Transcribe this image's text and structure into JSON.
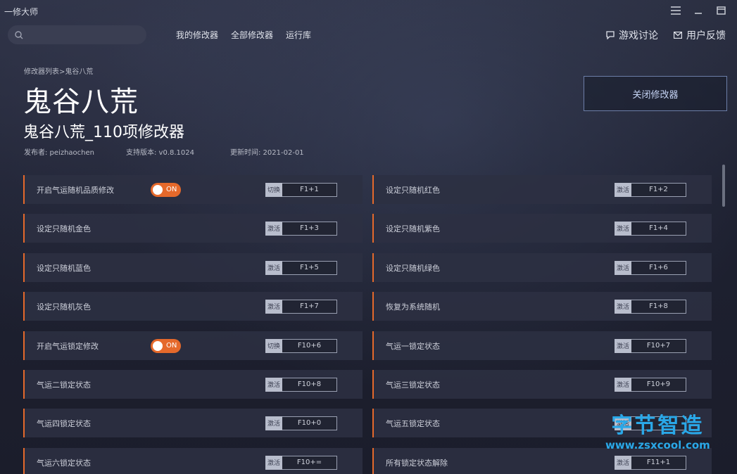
{
  "app": {
    "title": "一修大师"
  },
  "search": {
    "placeholder": ""
  },
  "nav": {
    "my_trainers": "我的修改器",
    "all_trainers": "全部修改器",
    "runtime": "运行库"
  },
  "right_nav": {
    "discussion": "游戏讨论",
    "feedback": "用户反馈"
  },
  "breadcrumb": "修改器列表>鬼谷八荒",
  "game_title": "鬼谷八荒",
  "trainer_title": "鬼谷八荒_110项修改器",
  "meta": {
    "publisher": "发布者:  peizhaochen",
    "version": "支持版本:  v0.8.1024",
    "updated": "更新时间:  2021-02-01"
  },
  "close_button": "关闭修改器",
  "cheats": [
    {
      "label": "开启气运随机品质修改",
      "toggle": "ON",
      "action": "切换",
      "key": "F1+1"
    },
    {
      "label": "设定只随机红色",
      "toggle": null,
      "action": "激活",
      "key": "F1+2"
    },
    {
      "label": "设定只随机金色",
      "toggle": null,
      "action": "激活",
      "key": "F1+3"
    },
    {
      "label": "设定只随机紫色",
      "toggle": null,
      "action": "激活",
      "key": "F1+4"
    },
    {
      "label": "设定只随机蓝色",
      "toggle": null,
      "action": "激活",
      "key": "F1+5"
    },
    {
      "label": "设定只随机绿色",
      "toggle": null,
      "action": "激活",
      "key": "F1+6"
    },
    {
      "label": "设定只随机灰色",
      "toggle": null,
      "action": "激活",
      "key": "F1+7"
    },
    {
      "label": "恢复为系统随机",
      "toggle": null,
      "action": "激活",
      "key": "F1+8"
    },
    {
      "label": "开启气运锁定修改",
      "toggle": "ON",
      "action": "切换",
      "key": "F10+6"
    },
    {
      "label": "气运一锁定状态",
      "toggle": null,
      "action": "激活",
      "key": "F10+7"
    },
    {
      "label": "气运二锁定状态",
      "toggle": null,
      "action": "激活",
      "key": "F10+8"
    },
    {
      "label": "气运三锁定状态",
      "toggle": null,
      "action": "激活",
      "key": "F10+9"
    },
    {
      "label": "气运四锁定状态",
      "toggle": null,
      "action": "激活",
      "key": "F10+0"
    },
    {
      "label": "气运五锁定状态",
      "toggle": null,
      "action": "激活",
      "key": ""
    },
    {
      "label": "气运六锁定状态",
      "toggle": null,
      "action": "激活",
      "key": "F10+="
    },
    {
      "label": "所有锁定状态解除",
      "toggle": null,
      "action": "激活",
      "key": "F11+1"
    }
  ],
  "watermark": {
    "line1": "字节智造",
    "line2": "www.zsxcool.com"
  },
  "colors": {
    "accent": "#e5692b",
    "button_border": "#6c7ea8",
    "watermark": "#2aa8e8"
  }
}
